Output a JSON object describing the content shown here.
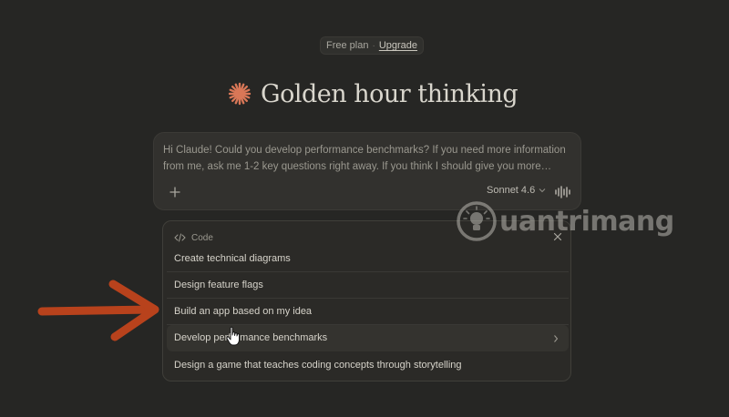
{
  "plan": {
    "label": "Free plan",
    "separator": "·",
    "upgrade_label": "Upgrade"
  },
  "greeting": {
    "title": "Golden hour thinking",
    "accent_color": "#d97757"
  },
  "composer": {
    "prompt_text": "Hi Claude! Could you develop performance benchmarks? If you need more information from me, ask me 1-2 key questions right away. If you think I should give you more context or upload anything to help you do a better job, let me know.",
    "add_icon": "plus-icon",
    "model_label": "Sonnet 4.6",
    "model_icon": "chevron-down-icon",
    "voice_icon": "waveform-icon"
  },
  "suggestions": {
    "category_label": "Code",
    "category_icon": "code-icon",
    "close_icon": "close-icon",
    "items": [
      {
        "label": "Create technical diagrams"
      },
      {
        "label": "Design feature flags"
      },
      {
        "label": "Build an app based on my idea"
      },
      {
        "label": "Develop performance benchmarks"
      },
      {
        "label": "Design a game that teaches coding concepts through storytelling"
      }
    ],
    "hovered_index": 3
  },
  "watermark": {
    "text": "uantrimang",
    "icon": "lightbulb-icon"
  },
  "annotation": {
    "arrow_color": "#b8421c",
    "icon": "arrow-right-icon"
  },
  "cursor": {
    "icon": "hand-pointer-icon"
  }
}
